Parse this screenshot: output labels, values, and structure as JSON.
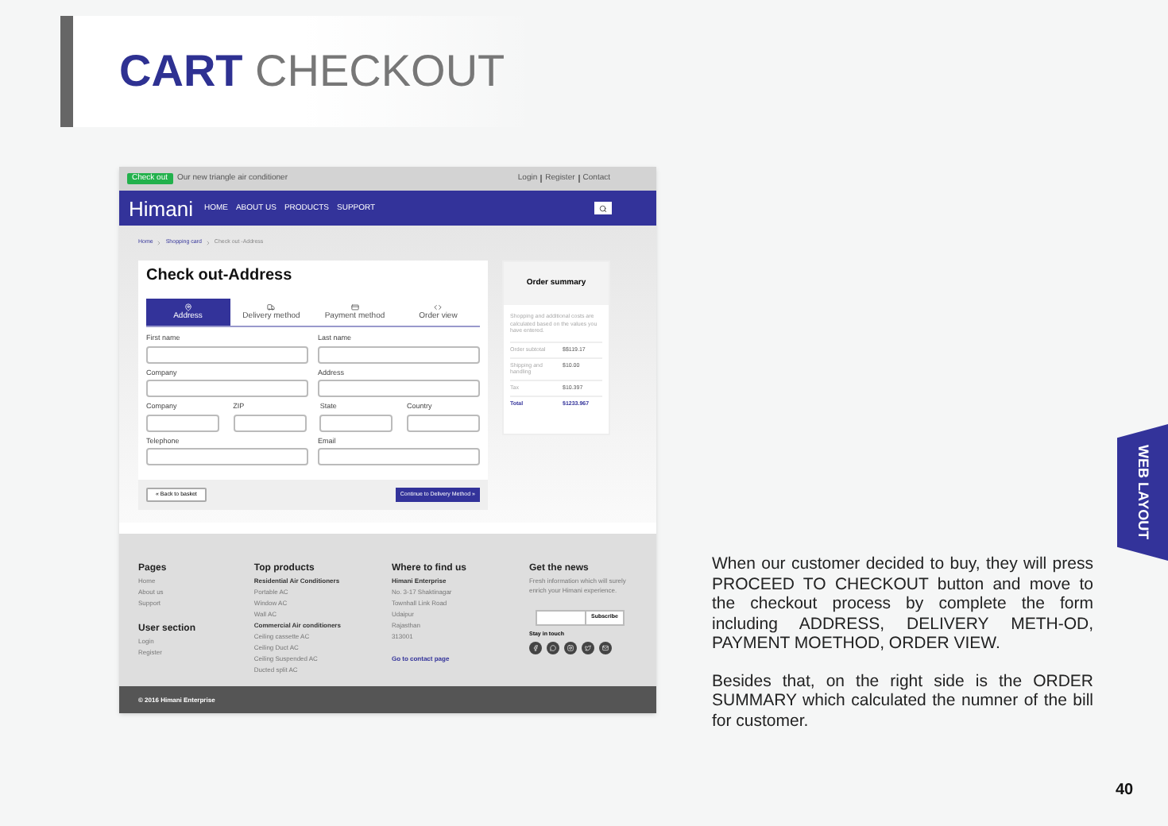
{
  "header": {
    "title_bold": "CART",
    "title_light": "CHECKOUT"
  },
  "site": {
    "top_bar": {
      "badge": "Check out",
      "promo": "Our new triangle air conditioner",
      "links": [
        "Login",
        "Register",
        "Contact"
      ]
    },
    "nav": {
      "logo": "Himani",
      "items": [
        "HOME",
        "ABOUT US",
        "PRODUCTS",
        "SUPPORT"
      ]
    },
    "breadcrumb": [
      "Home",
      "Shopping card",
      "Check out -Address"
    ],
    "checkout": {
      "title": "Check out-Address",
      "steps": [
        {
          "label": "Address",
          "selected": true
        },
        {
          "label": "Delivery method",
          "selected": false
        },
        {
          "label": "Payment method",
          "selected": false
        },
        {
          "label": "Order view",
          "selected": false
        }
      ],
      "rows": [
        [
          {
            "label": "First name"
          },
          {
            "label": "Last name"
          }
        ],
        [
          {
            "label": "Company"
          },
          {
            "label": "Address"
          }
        ],
        [
          {
            "label": "Company"
          },
          {
            "label": "ZIP"
          },
          {
            "label": "State"
          },
          {
            "label": "Country"
          }
        ],
        [
          {
            "label": "Telephone"
          },
          {
            "label": "Email"
          }
        ]
      ],
      "back_button": "« Back to basket",
      "continue_button": "Continue to Delivery Method »"
    },
    "summary": {
      "title": "Order summary",
      "note": "Shopping and additional costs are calculated based on the values you have entered.",
      "lines": [
        {
          "label": "Order subtotal",
          "value": "$$119.17",
          "kind": "normal"
        },
        {
          "label": "Shipping and handling",
          "value": "$10.00",
          "kind": "normal"
        },
        {
          "label": "Tax",
          "value": "$10.397",
          "kind": "normal"
        },
        {
          "label": "Total",
          "value": "$1233.967",
          "kind": "total"
        }
      ]
    },
    "footer": {
      "columns": [
        {
          "sections": [
            {
              "title": "Pages",
              "items": [
                {
                  "text": "Home",
                  "kind": "link"
                },
                {
                  "text": "About us",
                  "kind": "link"
                },
                {
                  "text": "Support",
                  "kind": "link"
                }
              ]
            },
            {
              "title": "User section",
              "items": [
                {
                  "text": "Login",
                  "kind": "link"
                },
                {
                  "text": "Register",
                  "kind": "link"
                }
              ]
            }
          ]
        },
        {
          "sections": [
            {
              "title": "Top products",
              "items": [
                {
                  "text": "Residential Air Conditioners",
                  "kind": "heading"
                },
                {
                  "text": "Portable AC",
                  "kind": "link"
                },
                {
                  "text": "Window AC",
                  "kind": "link"
                },
                {
                  "text": "Wall AC",
                  "kind": "link"
                },
                {
                  "text": "Commercial Air conditioners",
                  "kind": "heading"
                },
                {
                  "text": "Ceiling cassette AC",
                  "kind": "link"
                },
                {
                  "text": "Ceiling Duct AC",
                  "kind": "link"
                },
                {
                  "text": "Ceiling Suspended AC",
                  "kind": "link"
                },
                {
                  "text": "Ducted split AC",
                  "kind": "link"
                }
              ]
            }
          ]
        },
        {
          "sections": [
            {
              "title": "Where to find us",
              "items": [
                {
                  "text": "Himani Enterprise",
                  "kind": "heading"
                },
                {
                  "text": "No. 3-17 Shaktinagar",
                  "kind": "text"
                },
                {
                  "text": "Townhall Link Road",
                  "kind": "text"
                },
                {
                  "text": "Udaipur",
                  "kind": "text"
                },
                {
                  "text": "Rajasthan",
                  "kind": "text"
                },
                {
                  "text": "313001",
                  "kind": "text"
                },
                {
                  "text": "Go to contact page",
                  "kind": "contact"
                }
              ]
            }
          ]
        }
      ],
      "news": {
        "title": "Get the news",
        "text": "Fresh information which will surely enrich your Himani experience.",
        "subscribe": "Subscribe",
        "stay": "Stay in touch"
      },
      "copyright": "© 2016 Himani Enterprise"
    }
  },
  "tab": "WEB LAYOUT",
  "paragraphs": [
    "When our customer decided to buy, they will press PROCEED TO CHECKOUT button and move to the checkout process by complete the form including ADDRESS,  DELIVERY METH-OD, PAYMENT MOETHOD, ORDER VIEW.",
    "Besides that, on the right side is the ORDER SUMMARY which calculated the numner of the bill for customer."
  ],
  "page_number": "40"
}
